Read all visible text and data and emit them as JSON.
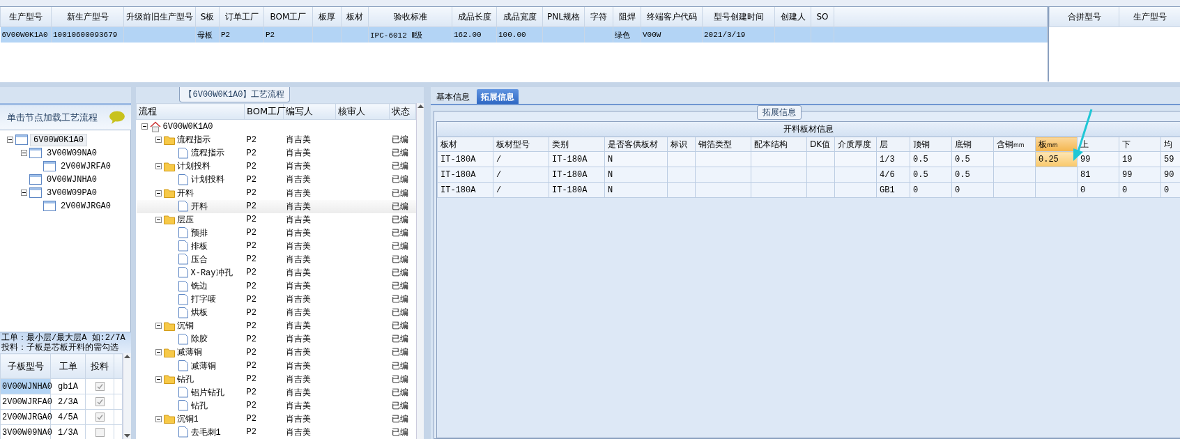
{
  "main_grid": {
    "columns": [
      "生产型号",
      "新生产型号",
      "升级前旧生产型号",
      "S板",
      "订单工厂",
      "BOM工厂",
      "板厚",
      "板材",
      "验收标准",
      "成品长度",
      "成品宽度",
      "PNL规格",
      "字符",
      "阻焊",
      "终端客户代码",
      "型号创建时间",
      "创建人",
      "SO"
    ],
    "rows": [
      {
        "selected": true,
        "cells": [
          "6V00W0K1A0",
          "10010600093679",
          "",
          "母板",
          "P2",
          "P2",
          "",
          "",
          "IPC-6012 Ⅱ级",
          "162.00",
          "100.00",
          "",
          "",
          "绿色",
          "V00W",
          "2021/3/19",
          "",
          ""
        ]
      }
    ]
  },
  "merge_grid": {
    "columns": [
      "合拼型号",
      "生产型号"
    ]
  },
  "child_tree": {
    "header": "单击节点加载工艺流程",
    "nodes": [
      {
        "label": "6V00W0K1A0",
        "selected": true,
        "expanded": true,
        "children": [
          {
            "label": "3V00W09NA0",
            "selected": false,
            "expanded": true,
            "children": [
              {
                "label": "2V00WJRFA0",
                "selected": false
              }
            ]
          },
          {
            "label": "0V00WJNHA0",
            "selected": false
          },
          {
            "label": "3V00W09PA0",
            "selected": false,
            "expanded": true,
            "children": [
              {
                "label": "2V00WJRGA0",
                "selected": false
              }
            ]
          }
        ]
      }
    ]
  },
  "hint": [
    "工单：最小层/最大层A 如:2/7A",
    "投料：子板是芯板开料的需勾选"
  ],
  "sub_grid": {
    "columns": [
      "子板型号",
      "工单",
      "投料"
    ],
    "rows": [
      {
        "cells": [
          "0V00WJNHA0",
          "gb1A"
        ],
        "checked": true,
        "selected": true
      },
      {
        "cells": [
          "2V00WJRFA0",
          "2/3A"
        ],
        "checked": true,
        "selected": false
      },
      {
        "cells": [
          "2V00WJRGA0",
          "4/5A"
        ],
        "checked": true,
        "selected": false
      },
      {
        "cells": [
          "3V00W09NA0",
          "1/3A"
        ],
        "checked": false,
        "selected": false
      }
    ]
  },
  "flow": {
    "title": "【6V00W0K1A0】工艺流程",
    "columns": [
      "流程",
      "BOM工厂",
      "编写人",
      "核审人",
      "状态"
    ],
    "nodes": [
      {
        "label": "6V00W0K1A0",
        "kind": "root",
        "expanded": true,
        "selected": false,
        "children": [
          {
            "label": "流程指示",
            "kind": "folder",
            "expanded": true,
            "selected": false,
            "bom": "P2",
            "writer": "肖吉美",
            "status": "已编",
            "children": [
              {
                "label": "流程指示",
                "kind": "step",
                "selected": false,
                "bom": "P2",
                "writer": "肖吉美",
                "status": "已编"
              }
            ]
          },
          {
            "label": "计划投料",
            "kind": "folder",
            "expanded": true,
            "selected": false,
            "bom": "P2",
            "writer": "肖吉美",
            "status": "已编",
            "children": [
              {
                "label": "计划投料",
                "kind": "step",
                "selected": false,
                "bom": "P2",
                "writer": "肖吉美",
                "status": "已编"
              }
            ]
          },
          {
            "label": "开料",
            "kind": "folder",
            "expanded": true,
            "selected": false,
            "bom": "P2",
            "writer": "肖吉美",
            "status": "已编",
            "children": [
              {
                "label": "开料",
                "kind": "step",
                "selected": true,
                "bom": "P2",
                "writer": "肖吉美",
                "status": "已编"
              }
            ]
          },
          {
            "label": "层压",
            "kind": "folder",
            "expanded": true,
            "selected": false,
            "bom": "P2",
            "writer": "肖吉美",
            "status": "已编",
            "children": [
              {
                "label": "预排",
                "kind": "step",
                "selected": false,
                "bom": "P2",
                "writer": "肖吉美",
                "status": "已编"
              },
              {
                "label": "排板",
                "kind": "step",
                "selected": false,
                "bom": "P2",
                "writer": "肖吉美",
                "status": "已编"
              },
              {
                "label": "压合",
                "kind": "step",
                "selected": false,
                "bom": "P2",
                "writer": "肖吉美",
                "status": "已编"
              },
              {
                "label": "X-Ray冲孔",
                "kind": "step",
                "selected": false,
                "bom": "P2",
                "writer": "肖吉美",
                "status": "已编"
              },
              {
                "label": "铣边",
                "kind": "step",
                "selected": false,
                "bom": "P2",
                "writer": "肖吉美",
                "status": "已编"
              },
              {
                "label": "打字唛",
                "kind": "step",
                "selected": false,
                "bom": "P2",
                "writer": "肖吉美",
                "status": "已编"
              },
              {
                "label": "烘板",
                "kind": "step",
                "selected": false,
                "bom": "P2",
                "writer": "肖吉美",
                "status": "已编"
              }
            ]
          },
          {
            "label": "沉铜",
            "kind": "folder",
            "expanded": true,
            "selected": false,
            "bom": "P2",
            "writer": "肖吉美",
            "status": "已编",
            "children": [
              {
                "label": "除胶",
                "kind": "step",
                "selected": false,
                "bom": "P2",
                "writer": "肖吉美",
                "status": "已编"
              }
            ]
          },
          {
            "label": "减薄铜",
            "kind": "folder",
            "expanded": true,
            "selected": false,
            "bom": "P2",
            "writer": "肖吉美",
            "status": "已编",
            "children": [
              {
                "label": "减薄铜",
                "kind": "step",
                "selected": false,
                "bom": "P2",
                "writer": "肖吉美",
                "status": "已编"
              }
            ]
          },
          {
            "label": "钻孔",
            "kind": "folder",
            "expanded": true,
            "selected": false,
            "bom": "P2",
            "writer": "肖吉美",
            "status": "已编",
            "children": [
              {
                "label": "铝片钻孔",
                "kind": "step",
                "selected": false,
                "bom": "P2",
                "writer": "肖吉美",
                "status": "已编"
              },
              {
                "label": "钻孔",
                "kind": "step",
                "selected": false,
                "bom": "P2",
                "writer": "肖吉美",
                "status": "已编"
              }
            ]
          },
          {
            "label": "沉铜1",
            "kind": "folder",
            "expanded": true,
            "selected": false,
            "bom": "P2",
            "writer": "肖吉美",
            "status": "已编",
            "children": [
              {
                "label": "去毛刺1",
                "kind": "step",
                "selected": false,
                "bom": "P2",
                "writer": "肖吉美",
                "status": "已编"
              }
            ]
          }
        ]
      }
    ]
  },
  "tabs": [
    {
      "label": "基本信息",
      "selected": false
    },
    {
      "label": "拓展信息",
      "selected": true
    }
  ],
  "ext": {
    "group_title": "拓展信息",
    "table_title": "开料板材信息",
    "columns": [
      {
        "label": "板材",
        "selected": false
      },
      {
        "label": "板材型号",
        "selected": false
      },
      {
        "label": "类别",
        "selected": false
      },
      {
        "label": "是否客供板材",
        "selected": false
      },
      {
        "label": "标识",
        "selected": false
      },
      {
        "label": "铜箔类型",
        "selected": false
      },
      {
        "label": "配本结构",
        "selected": false
      },
      {
        "label": "DK值",
        "selected": false
      },
      {
        "label": "介质厚度",
        "selected": false
      },
      {
        "label": "层",
        "selected": false
      },
      {
        "label": "顶铜",
        "selected": false
      },
      {
        "label": "底铜",
        "selected": false
      },
      {
        "label": "含铜$_{mm}$",
        "selected": false
      },
      {
        "label": "板$_{mm}$",
        "selected": true
      },
      {
        "label": "上",
        "selected": false
      },
      {
        "label": "下",
        "selected": false
      },
      {
        "label": "均",
        "selected": false
      }
    ],
    "rows": [
      {
        "selected": true,
        "cells": [
          "IT-180A",
          "/",
          "IT-180A",
          "N",
          "",
          "",
          "",
          "",
          "",
          "1/3",
          "0.5",
          "0.5",
          "",
          "0.25",
          "99",
          "19",
          "59"
        ]
      },
      {
        "selected": false,
        "cells": [
          "IT-180A",
          "/",
          "IT-180A",
          "N",
          "",
          "",
          "",
          "",
          "",
          "4/6",
          "0.5",
          "0.5",
          "",
          "",
          "81",
          "99",
          "90"
        ]
      },
      {
        "selected": false,
        "cells": [
          "IT-180A",
          "/",
          "IT-180A",
          "N",
          "",
          "",
          "",
          "",
          "",
          "GB1",
          "0",
          "0",
          "",
          "",
          "0",
          "0",
          "0"
        ]
      }
    ]
  }
}
